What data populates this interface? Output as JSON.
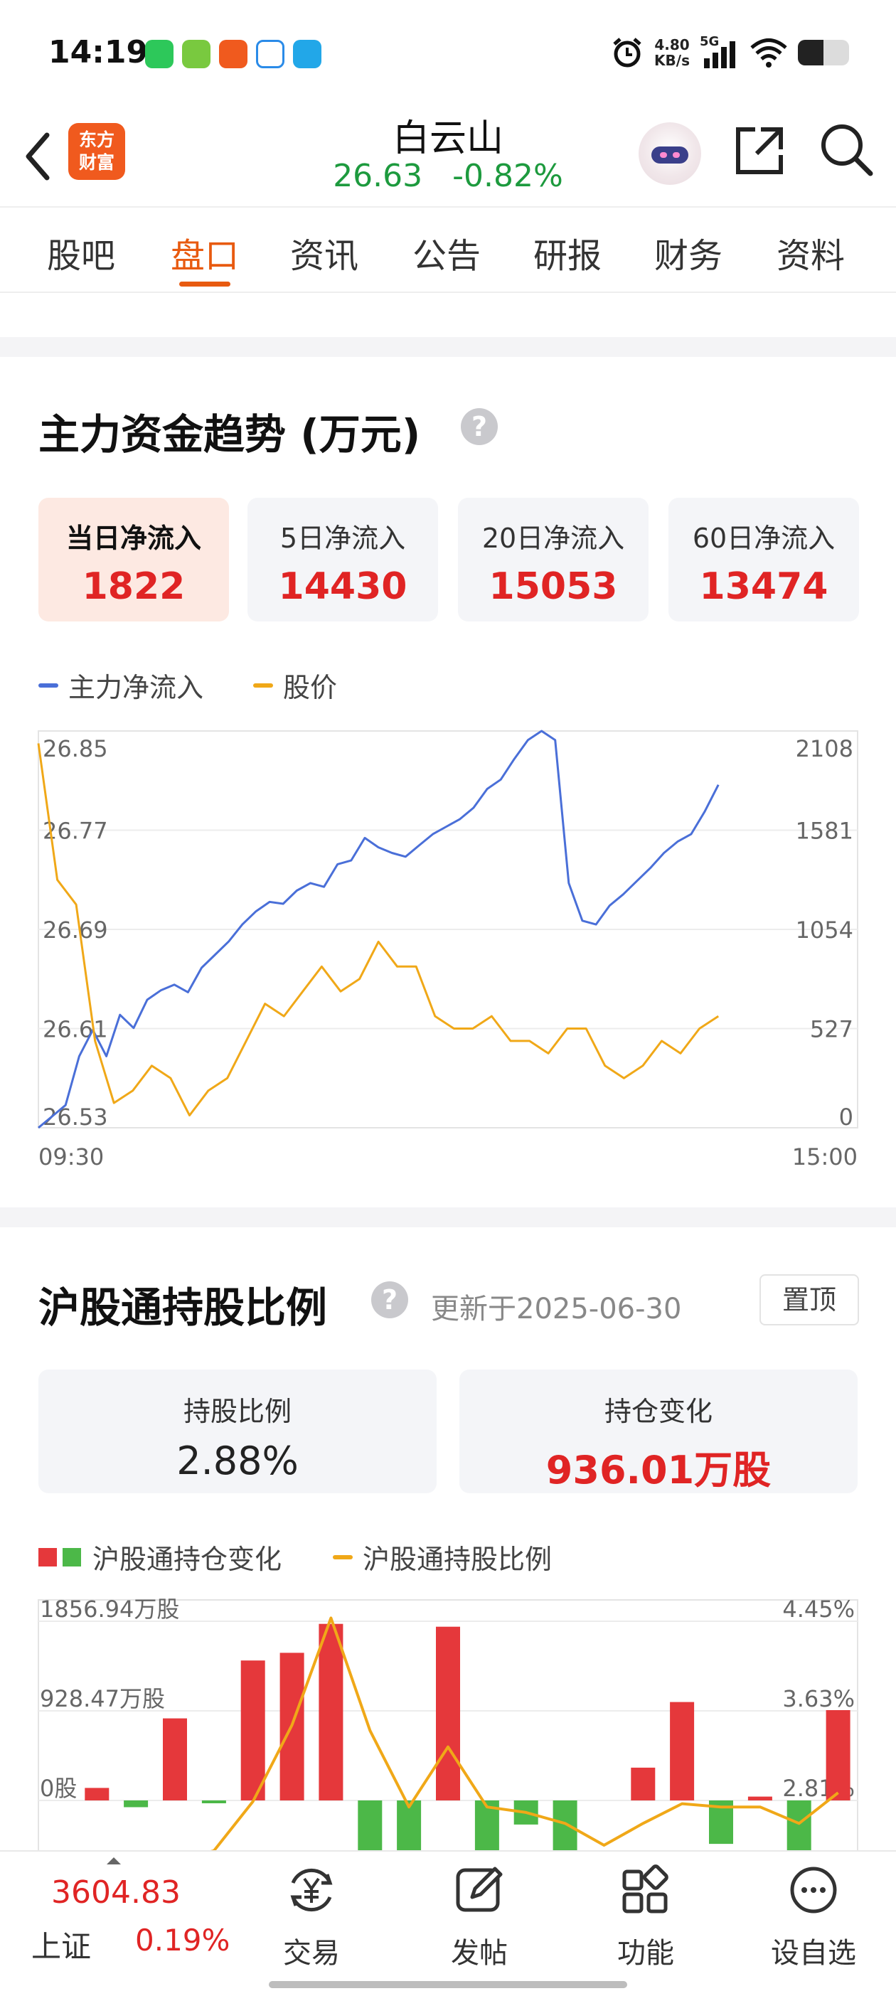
{
  "status_bar": {
    "time": "14:19",
    "net_speed_value": "4.80",
    "net_speed_unit": "KB/s",
    "network": "5G",
    "app_icons": [
      "wechat-icon",
      "app-icon",
      "app-icon",
      "telecom-icon",
      "app-icon"
    ],
    "battery_level": 0.5
  },
  "header": {
    "logo_line1": "东方",
    "logo_line2": "财富",
    "stock_name": "白云山",
    "price": "26.63",
    "change_pct": "-0.82%"
  },
  "tabs": [
    {
      "label": "股吧",
      "active": false
    },
    {
      "label": "盘口",
      "active": true
    },
    {
      "label": "资讯",
      "active": false
    },
    {
      "label": "公告",
      "active": false
    },
    {
      "label": "研报",
      "active": false
    },
    {
      "label": "财务",
      "active": false
    },
    {
      "label": "资料",
      "active": false
    }
  ],
  "fund_trend": {
    "title": "主力资金趋势 (万元)",
    "help": "?",
    "cards": [
      {
        "label": "当日净流入",
        "value": "1822",
        "active": true
      },
      {
        "label": "5日净流入",
        "value": "14430",
        "active": false
      },
      {
        "label": "20日净流入",
        "value": "15053",
        "active": false
      },
      {
        "label": "60日净流入",
        "value": "13474",
        "active": false
      }
    ],
    "legend": [
      {
        "label": "主力净流入",
        "color": "#4a6fd8"
      },
      {
        "label": "股价",
        "color": "#f0a818"
      }
    ]
  },
  "northbound": {
    "title": "沪股通持股比例",
    "help": "?",
    "updated": "更新于2025-06-30",
    "pin_label": "置顶",
    "cards": [
      {
        "label": "持股比例",
        "value": "2.88%"
      },
      {
        "label": "持仓变化",
        "value": "936.01万股"
      }
    ],
    "legend": [
      {
        "label": "沪股通持仓变化",
        "colors": [
          "#e5383b",
          "#4cb848"
        ]
      },
      {
        "label": "沪股通持股比例",
        "color": "#f0a818"
      }
    ]
  },
  "chart_data": [
    {
      "type": "line",
      "x_labels": [
        "09:30",
        "15:00"
      ],
      "y_left_ticks": [
        "26.85",
        "26.77",
        "26.69",
        "26.61",
        "26.53"
      ],
      "y_right_ticks": [
        "2108",
        "1581",
        "1054",
        "527",
        "0"
      ],
      "ylim_left": [
        26.53,
        26.85
      ],
      "ylim_right": [
        0,
        2108
      ],
      "grid": true,
      "series": [
        {
          "name": "主力净流入",
          "color": "#4a6fd8",
          "axis": "right",
          "values": [
            0,
            60,
            120,
            380,
            520,
            380,
            600,
            530,
            680,
            730,
            760,
            720,
            850,
            920,
            990,
            1080,
            1150,
            1200,
            1190,
            1260,
            1300,
            1280,
            1400,
            1420,
            1540,
            1490,
            1460,
            1440,
            1500,
            1560,
            1600,
            1640,
            1700,
            1800,
            1850,
            1960,
            2060,
            2108,
            2060,
            1300,
            1100,
            1080,
            1180,
            1240,
            1310,
            1380,
            1460,
            1520,
            1560,
            1680,
            1822
          ]
        },
        {
          "name": "股价",
          "color": "#f0a818",
          "axis": "left",
          "values": [
            26.84,
            26.73,
            26.71,
            26.6,
            26.55,
            26.56,
            26.58,
            26.57,
            26.54,
            26.56,
            26.57,
            26.6,
            26.63,
            26.62,
            26.64,
            26.66,
            26.64,
            26.65,
            26.68,
            26.66,
            26.66,
            26.62,
            26.61,
            26.61,
            26.62,
            26.6,
            26.6,
            26.59,
            26.61,
            26.61,
            26.58,
            26.57,
            26.58,
            26.6,
            26.59,
            26.61,
            26.62
          ]
        }
      ]
    },
    {
      "type": "bar",
      "y_left_ticks": [
        "1856.94万股",
        "928.47万股",
        "0股"
      ],
      "y_right_ticks": [
        "4.45%",
        "3.63%",
        "2.81%"
      ],
      "ylim_left": [
        0,
        1856.94
      ],
      "ylim_right": [
        2.81,
        4.45
      ],
      "grid": true,
      "series": [
        {
          "name": "沪股通持仓变化",
          "unit": "万股",
          "values": [
            0,
            130,
            -70,
            850,
            -20,
            1450,
            1530,
            1830,
            -700,
            -520,
            1800,
            -560,
            -250,
            -580,
            0,
            340,
            1020,
            -450,
            40,
            -520,
            936.01
          ]
        },
        {
          "name": "沪股通持股比例",
          "color": "#f0a818",
          "unit": "%",
          "values": [
            2.1,
            2.2,
            2.2,
            2.25,
            2.35,
            2.8,
            3.5,
            4.48,
            3.45,
            2.75,
            3.3,
            2.75,
            2.7,
            2.6,
            2.4,
            2.6,
            2.78,
            2.75,
            2.75,
            2.6,
            2.88
          ]
        }
      ]
    }
  ],
  "bottom_bar": {
    "index_value": "3604.83",
    "index_name": "上证",
    "index_change": "0.19%",
    "buttons": [
      {
        "label": "交易",
        "icon": "trade-icon"
      },
      {
        "label": "发帖",
        "icon": "edit-icon"
      },
      {
        "label": "功能",
        "icon": "grid-icon"
      },
      {
        "label": "设自选",
        "icon": "more-icon"
      }
    ]
  }
}
